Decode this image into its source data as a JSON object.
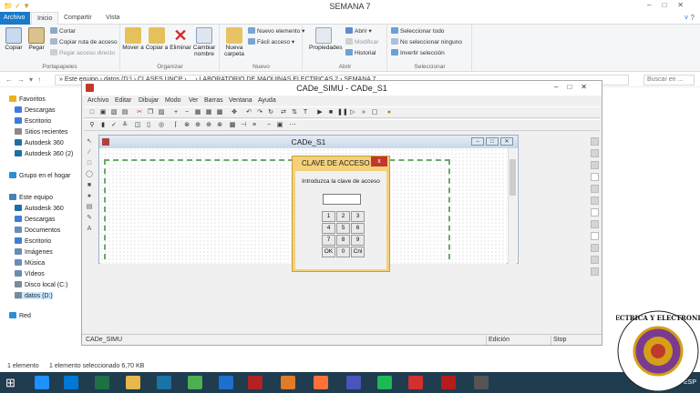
{
  "explorer": {
    "window_title": "SEMANA 7",
    "tabs": [
      "Archivo",
      "Inicio",
      "Compartir",
      "Vista"
    ],
    "ribbon": {
      "portapapeles": {
        "label": "Portapapeles",
        "copiar": "Copiar",
        "pegar": "Pegar",
        "cortar": "Cortar",
        "copiar_ruta": "Copiar ruta de acceso",
        "pegar_acceso": "Pegar acceso directo"
      },
      "organizar": {
        "label": "Organizar",
        "mover": "Mover a",
        "copiar_a": "Copiar a",
        "eliminar": "Eliminar",
        "cambiar_nombre": "Cambiar nombre"
      },
      "nuevo": {
        "label": "Nuevo",
        "nueva_carpeta": "Nueva carpeta",
        "nuevo_elemento": "Nuevo elemento",
        "facil_acceso": "Fácil acceso"
      },
      "abrir": {
        "label": "Abrir",
        "propiedades": "Propiedades",
        "abrir": "Abrir",
        "modificar": "Modificar",
        "historial": "Historial"
      },
      "seleccionar": {
        "label": "Seleccionar",
        "todo": "Seleccionar todo",
        "ninguno": "No seleccionar ninguno",
        "invertir": "Invertir selección"
      }
    },
    "address": "» Este equipo › datos (D:) › CLASES UNCP › ... › LABORATORIO DE MAQUINAS ELECTRICAS 2 › SEMANA 7",
    "search_placeholder": "Buscar en ...",
    "nav": [
      {
        "label": "Favoritos",
        "icon": "star-icon",
        "color": "#e8b21a"
      },
      {
        "label": "Descargas",
        "icon": "download-folder-icon",
        "color": "#3b7dd8"
      },
      {
        "label": "Escritorio",
        "icon": "desktop-icon",
        "color": "#3b7dd8"
      },
      {
        "label": "Sitios recientes",
        "icon": "recent-icon",
        "color": "#8a8a8a"
      },
      {
        "label": "Autodesk 360",
        "icon": "cloud-icon",
        "color": "#1c6fa8"
      },
      {
        "label": "Autodesk 360 (2)",
        "icon": "cloud-icon",
        "color": "#1c6fa8"
      },
      {
        "label": "Grupo en el hogar",
        "icon": "homegroup-icon",
        "color": "#2a8fd6"
      },
      {
        "label": "Este equipo",
        "icon": "computer-icon",
        "color": "#4a7fb5"
      },
      {
        "label": "Autodesk 360",
        "icon": "cloud-icon",
        "color": "#1c6fa8"
      },
      {
        "label": "Descargas",
        "icon": "download-folder-icon",
        "color": "#3b7dd8"
      },
      {
        "label": "Documentos",
        "icon": "documents-icon",
        "color": "#6a8bb5"
      },
      {
        "label": "Escritorio",
        "icon": "desktop-icon",
        "color": "#3b7dd8"
      },
      {
        "label": "Imágenes",
        "icon": "pictures-icon",
        "color": "#6a8bb5"
      },
      {
        "label": "Música",
        "icon": "music-icon",
        "color": "#6a8bb5"
      },
      {
        "label": "Vídeos",
        "icon": "videos-icon",
        "color": "#6a8bb5"
      },
      {
        "label": "Disco local (C:)",
        "icon": "drive-icon",
        "color": "#7a8a99"
      },
      {
        "label": "datos (D:)",
        "icon": "drive-icon",
        "color": "#7a8a99"
      },
      {
        "label": "Red",
        "icon": "network-icon",
        "color": "#2a8fd6"
      }
    ],
    "status": {
      "count": "1 elemento",
      "selected": "1 elemento seleccionado  6,70 KB"
    }
  },
  "cade": {
    "title": "CADe_SIMU - CADe_S1",
    "menu": [
      "Archivo",
      "Editar",
      "Dibujar",
      "Modo",
      "Ver",
      "Barras",
      "Ventana",
      "Ayuda"
    ],
    "child_title": "CADe_S1",
    "status": {
      "app": "CADe_SIMU",
      "mode": "Edición",
      "state": "Stop"
    }
  },
  "dialog": {
    "title": "CLAVE DE ACCESO",
    "close": "x",
    "prompt": "Introduzca la clave de acceso",
    "keys": [
      "1",
      "2",
      "3",
      "4",
      "5",
      "6",
      "7",
      "8",
      "9",
      "OK",
      "0",
      "Cnl"
    ]
  },
  "taskbar": {
    "tray_label": "ESP",
    "icons": [
      "start-icon",
      "ie-icon",
      "edge-icon",
      "spreadsheet-icon",
      "folder-icon",
      "store-icon",
      "chrome-icon",
      "windows-icon",
      "cade-icon",
      "matlab-icon",
      "firefox-icon",
      "teams-icon",
      "spotify-icon",
      "pdf-icon",
      "autocad-icon",
      "obs-icon"
    ]
  },
  "colors": {
    "accent": "#1979ca",
    "dialog": "#f3d17a",
    "close_red": "#c0392b",
    "taskbar": "#203c4f",
    "frame_green": "#6ca86c"
  }
}
